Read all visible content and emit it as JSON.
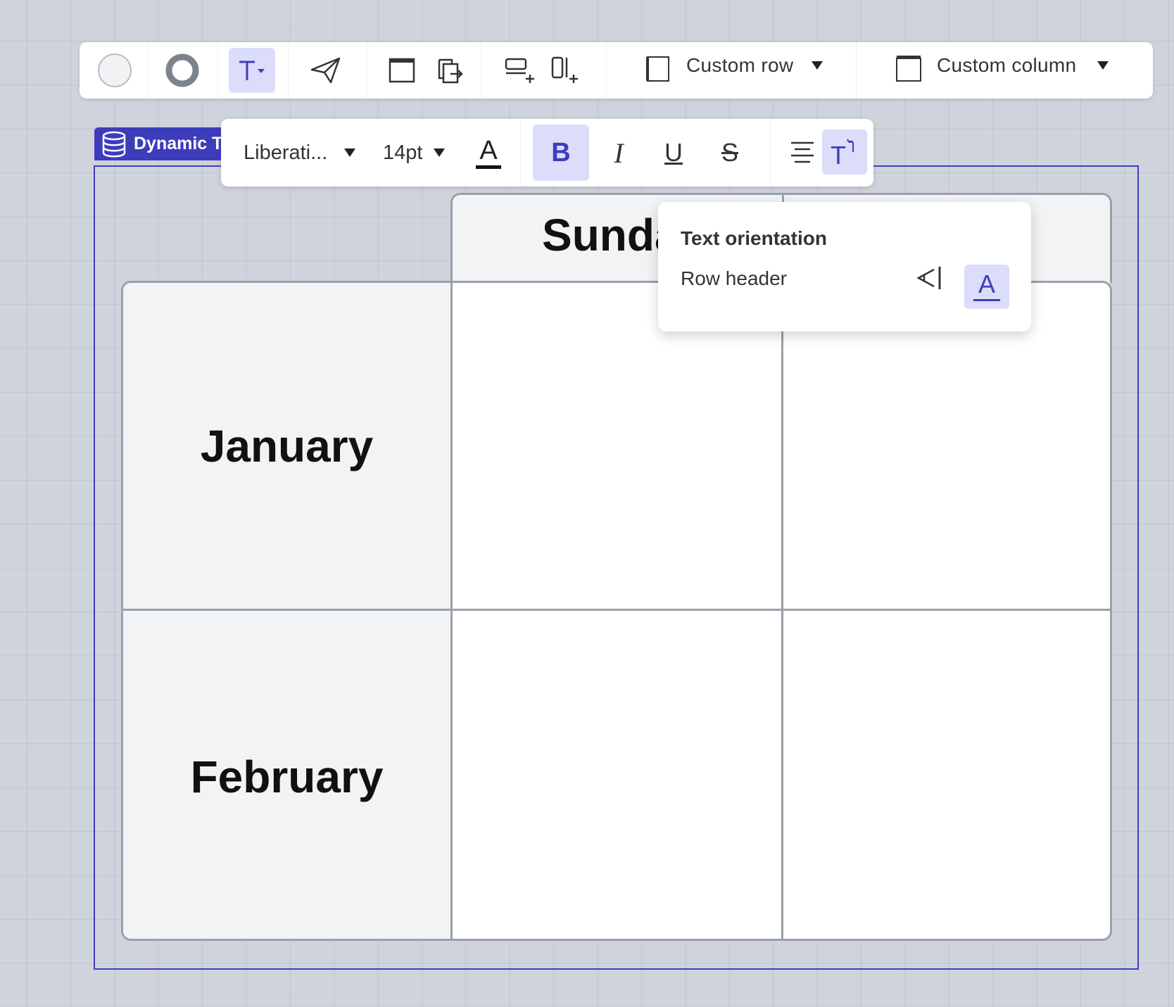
{
  "toolbar": {
    "custom_row_label": "Custom row",
    "custom_column_label": "Custom column"
  },
  "badge": {
    "label": "Dynamic Ta"
  },
  "format": {
    "font_name": "Liberati...",
    "font_size": "14pt",
    "bold_label": "B",
    "italic_label": "I",
    "underline_label": "U",
    "strike_label": "S",
    "text_color_glyph": "A",
    "orientation_glyph": "T"
  },
  "table": {
    "column_header": "Sunda",
    "rows": [
      "January",
      "February"
    ]
  },
  "popover": {
    "title": "Text orientation",
    "row_label": "Row header",
    "horizontal_glyph": "A"
  },
  "colors": {
    "accent": "#3d3dbb",
    "active_bg": "#dcdcfb",
    "canvas": "#cfd4dc",
    "table_border": "#9aa0a8",
    "header_bg": "#f2f3f5"
  }
}
